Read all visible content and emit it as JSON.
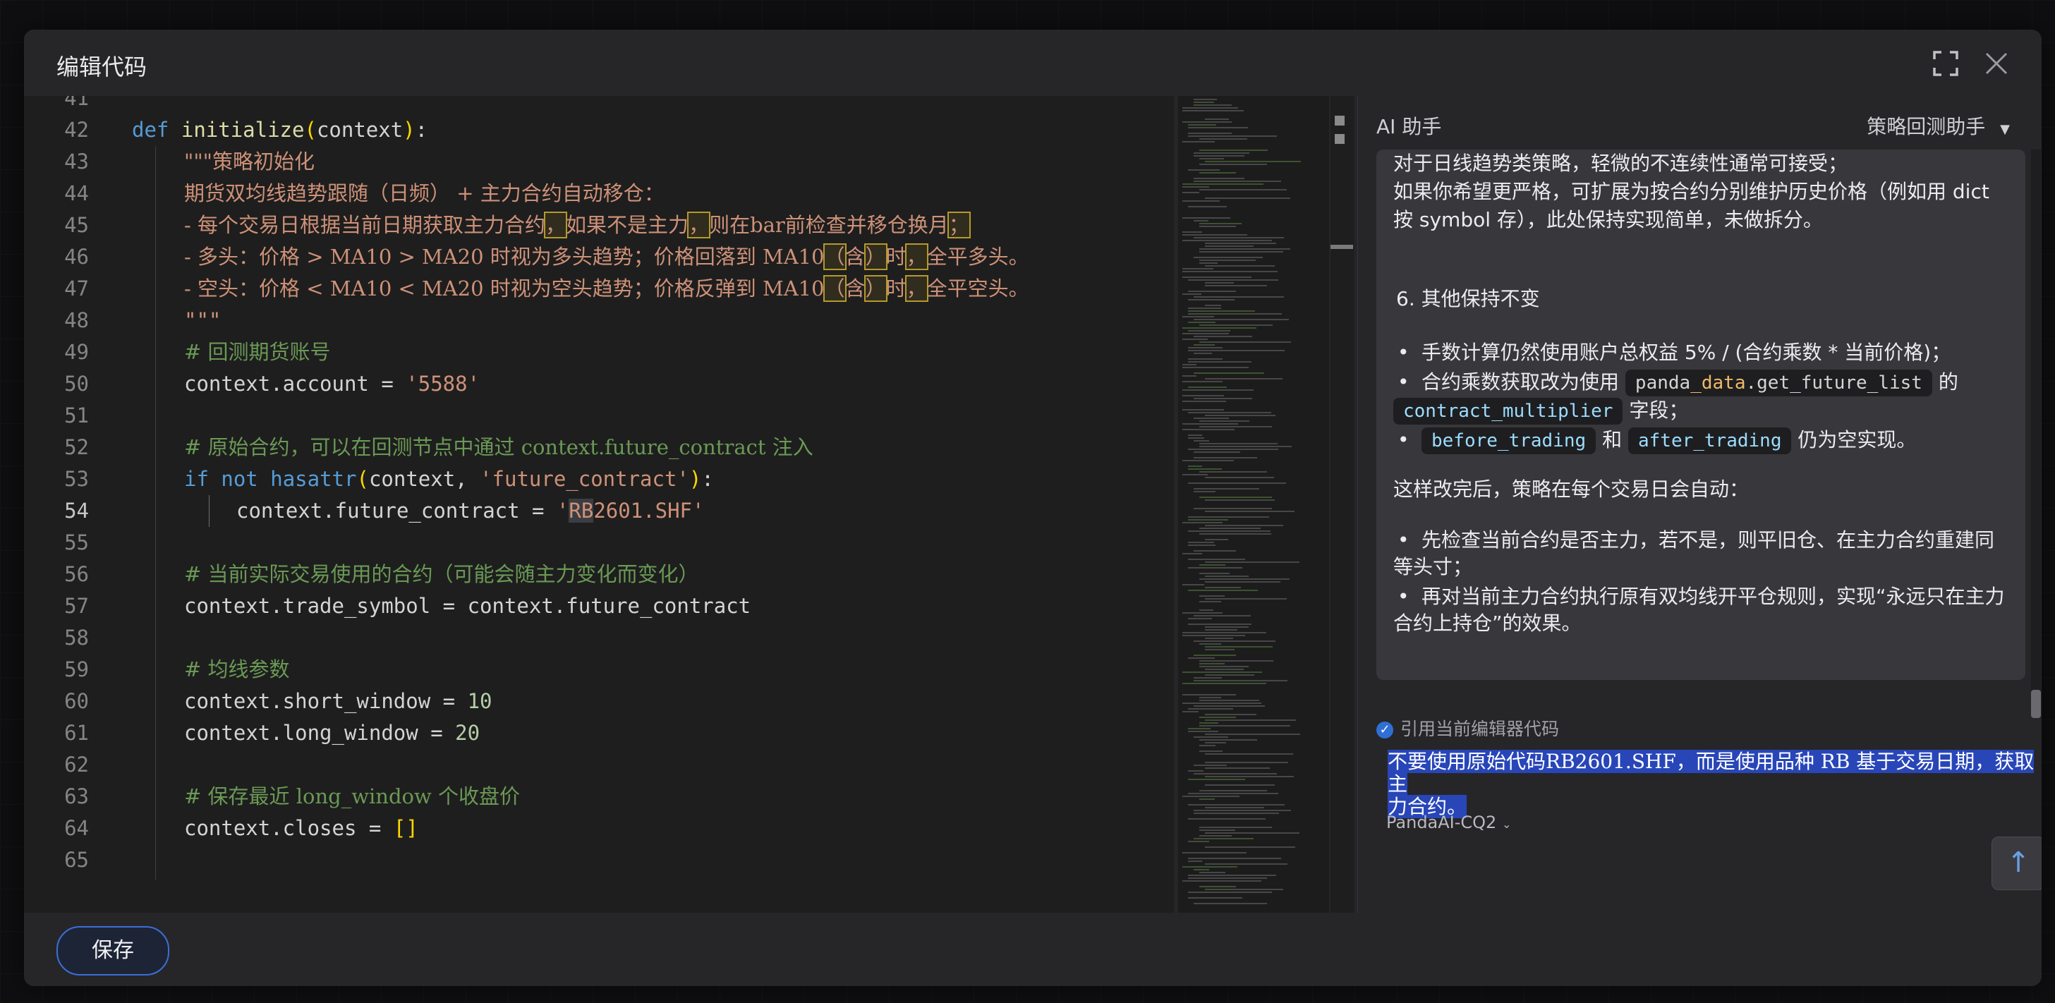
{
  "modal": {
    "title": "编辑代码"
  },
  "editor": {
    "lines": [
      {
        "n": "41"
      },
      {
        "n": "42"
      },
      {
        "n": "43"
      },
      {
        "n": "44"
      },
      {
        "n": "45"
      },
      {
        "n": "46"
      },
      {
        "n": "47"
      },
      {
        "n": "48"
      },
      {
        "n": "49"
      },
      {
        "n": "50"
      },
      {
        "n": "51"
      },
      {
        "n": "52"
      },
      {
        "n": "53"
      },
      {
        "n": "54"
      },
      {
        "n": "55"
      },
      {
        "n": "56"
      },
      {
        "n": "57"
      },
      {
        "n": "58"
      },
      {
        "n": "59"
      },
      {
        "n": "60"
      },
      {
        "n": "61"
      },
      {
        "n": "62"
      },
      {
        "n": "63"
      },
      {
        "n": "64"
      },
      {
        "n": "65"
      }
    ],
    "current_line": "54",
    "code": {
      "l42": [
        "def",
        "initialize",
        "(",
        "context",
        ")",
        ":"
      ],
      "l43": "\"\"\"策略初始化",
      "l44": "期货双均线趋势跟随（日频） + 主力合约自动移仓：",
      "l45": [
        "- 每个交易日根据当前日期获取主力合约",
        "，",
        "如果不是主力",
        "，",
        "则在bar前检查并移仓换月",
        "；"
      ],
      "l46": [
        "- 多头：价格 > MA10 > MA20 时视为多头趋势；价格回落到 MA10",
        "（",
        "含",
        "）",
        "时",
        "，",
        "全平多头。"
      ],
      "l47": [
        "- 空头：价格 < MA10 < MA20 时视为空头趋势；价格反弹到 MA10",
        "（",
        "含",
        "）",
        "时",
        "，",
        "全平空头。"
      ],
      "l48": "\"\"\"",
      "l49": "# 回测期货账号",
      "l50": [
        "context.account = ",
        "'5588'"
      ],
      "l52": "# 原始合约，可以在回测节点中通过 context.future_contract 注入",
      "l53": [
        "if",
        "not",
        "hasattr",
        "(",
        "context, ",
        "'future_contract'",
        ")",
        ":"
      ],
      "l54": [
        "context.future_contract = ",
        "'",
        "RB",
        "2601.SHF'"
      ],
      "l56": "# 当前实际交易使用的合约（可能会随主力变化而变化）",
      "l57": "context.trade_symbol = context.future_contract",
      "l59": "# 均线参数",
      "l60": [
        "context.short_window = ",
        "10"
      ],
      "l61": [
        "context.long_window = ",
        "20"
      ],
      "l63": "# 保存最近 long_window 个收盘价",
      "l64": [
        "context.closes = ",
        "[]"
      ]
    }
  },
  "ai": {
    "title": "AI 助手",
    "mode": "策略回测助手",
    "msg": {
      "p1a": "对于日线趋势类策略，轻微的不连续性通常可接受；",
      "p1b": "如果你希望更严格，可扩展为按合约分别维护历史价格（例如用 dict",
      "p1c": "按 symbol 存），此处保持实现简单，未做拆分。",
      "h6": "6. 其他保持不变",
      "b1": "手数计算仍然使用账户总权益 5% / (合约乘数 * 当前价格)；",
      "b2a": "合约乘数获取改为使用",
      "b2_code_a": "panda",
      "b2_code_b": "_data",
      "b2_code_c": ".get_future_list",
      "b2b": "的",
      "b2_code2": "contract_multiplier",
      "b2c": "字段；",
      "b3_code1": "before_trading",
      "b3a": "和",
      "b3_code2": "after_trading",
      "b3b": "仍为空实现。",
      "p2": "这样改完后，策略在每个交易日会自动：",
      "b4a": "先检查当前合约是否主力，若不是，则平旧仓、在主力合约重建同",
      "b4b": "等头寸；",
      "b5a": "再对当前主力合约执行原有双均线开平仓规则，实现“永远只在主力",
      "b5b": "合约上持仓”的效果。"
    },
    "reference_label": "引用当前编辑器代码",
    "input_text_a": "不要使用原始代码RB2601.SHF，而是使用品种 RB 基于交易日期，获取主",
    "input_text_b": "力合约。",
    "model": "PandaAI-CQ2"
  },
  "footer": {
    "save_label": "保存"
  },
  "colors": {
    "accent": "#3a6fd8",
    "selection": "#2846b8"
  },
  "icons": {
    "fullscreen": "fullscreen-icon",
    "close": "close-icon",
    "send": "arrow-up-icon",
    "check": "check-circle-icon",
    "dropdown": "caret-down-icon"
  }
}
